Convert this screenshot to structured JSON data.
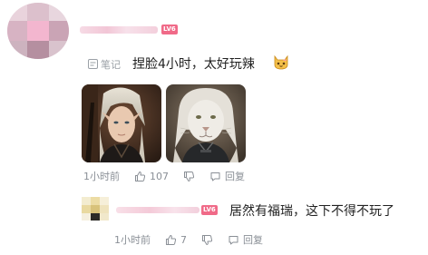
{
  "comment1": {
    "badge": "LV6",
    "note_tag": "笔记",
    "text": "捏脸4小时，太好玩辣",
    "emoji_icon": "cat-face-icon",
    "time": "1小时前",
    "likes": "107",
    "reply": "回复"
  },
  "comment2": {
    "badge": "LV6",
    "text": "居然有福瑞，这下不得不玩了",
    "time": "1小时前",
    "likes": "7",
    "reply": "回复"
  }
}
